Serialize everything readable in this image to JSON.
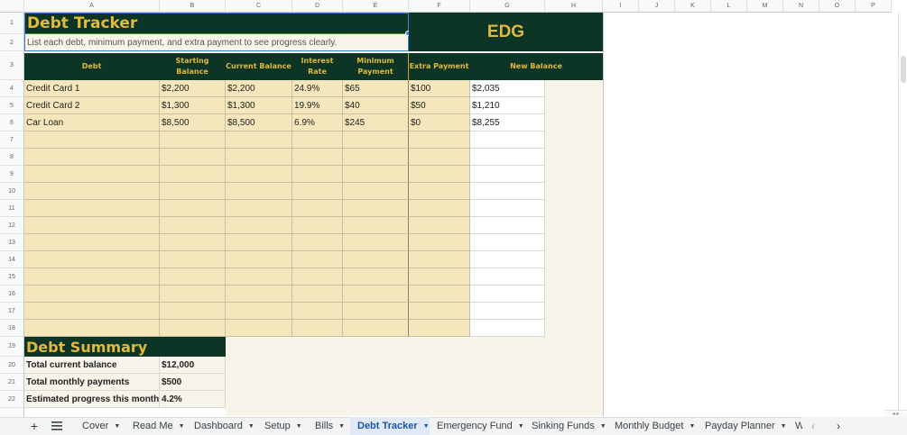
{
  "column_headers": [
    "A",
    "B",
    "C",
    "D",
    "E",
    "F",
    "G",
    "H",
    "I",
    "J",
    "K",
    "L",
    "M",
    "N",
    "O",
    "P"
  ],
  "row_numbers": [
    "1",
    "2",
    "3",
    "4",
    "5",
    "6",
    "7",
    "8",
    "9",
    "10",
    "11",
    "12",
    "13",
    "14",
    "15",
    "16",
    "17",
    "18",
    "19",
    "20",
    "21",
    "22"
  ],
  "title": "Debt Tracker",
  "subtitle": "List each debt, minimum payment, and extra payment to see progress clearly.",
  "brand": "EDG",
  "table": {
    "headers": [
      "Debt",
      "Starting Balance",
      "Current Balance",
      "Interest Rate",
      "Minimum Payment",
      "Extra Payment",
      "New Balance"
    ],
    "rows": [
      [
        "Credit Card 1",
        "$2,200",
        "$2,200",
        "24.9%",
        "$65",
        "$100",
        "$2,035"
      ],
      [
        "Credit Card 2",
        "$1,300",
        "$1,300",
        "19.9%",
        "$40",
        "$50",
        "$1,210"
      ],
      [
        "Car Loan",
        "$8,500",
        "$8,500",
        "6.9%",
        "$245",
        "$0",
        "$8,255"
      ]
    ]
  },
  "summary": {
    "title": "Debt Summary",
    "rows": [
      {
        "label": "Total current balance",
        "value": "$12,000"
      },
      {
        "label": "Total monthly payments",
        "value": "$500"
      },
      {
        "label": "Estimated progress this month",
        "value": "4.2%"
      }
    ]
  },
  "sheet_tabs": [
    {
      "label": "Cover",
      "active": false
    },
    {
      "label": "Read Me",
      "active": false
    },
    {
      "label": "Dashboard",
      "active": false
    },
    {
      "label": "Setup",
      "active": false
    },
    {
      "label": "Bills",
      "active": false
    },
    {
      "label": "Debt Tracker",
      "active": true
    },
    {
      "label": "Emergency Fund",
      "active": false
    },
    {
      "label": "Sinking Funds",
      "active": false
    },
    {
      "label": "Monthly Budget",
      "active": false
    },
    {
      "label": "Payday Planner",
      "active": false
    },
    {
      "label": "W",
      "active": false
    }
  ],
  "icons": {
    "add_sheet": "plus-icon",
    "all_sheets": "menu-icon",
    "scroll_left": "chevron-left-icon",
    "scroll_right": "chevron-right-icon"
  },
  "colors": {
    "header_green": "#0c3526",
    "header_gold": "#e2b93b",
    "cell_tan": "#f5e6bb",
    "panel_bg": "#f7f4ea",
    "active_tab": "#e1e9f6",
    "active_tab_text": "#1a56a8"
  }
}
